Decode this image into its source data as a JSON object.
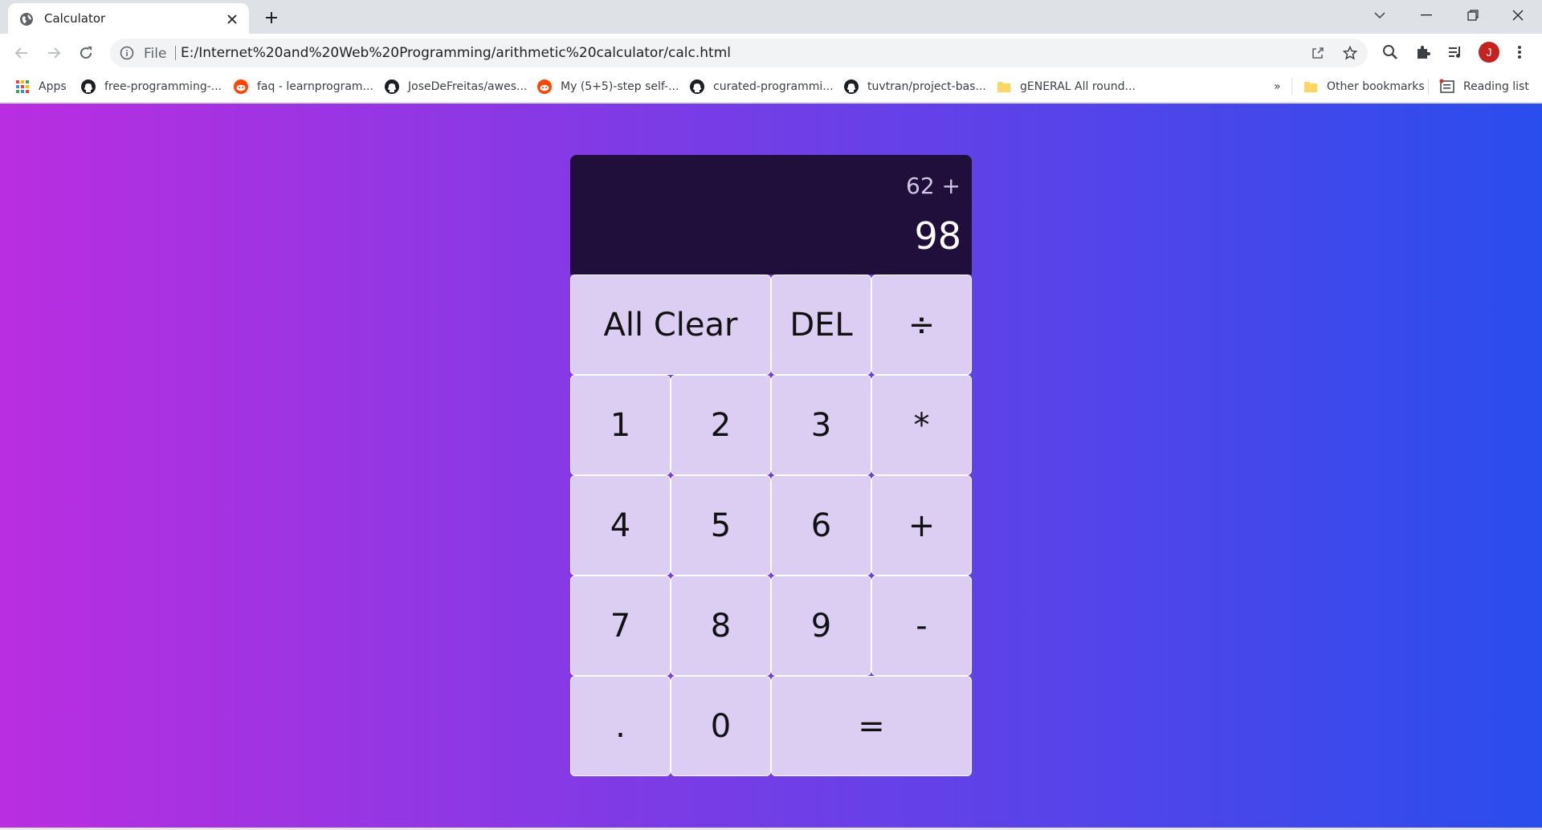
{
  "browser": {
    "tab_title": "Calculator",
    "omnibox_scheme": "File",
    "url": "E:/Internet%20and%20Web%20Programming/arithmetic%20calculator/calc.html",
    "avatar_initial": "J"
  },
  "bookmarks": {
    "items": [
      {
        "label": "Apps",
        "icon": "apps-grid-icon"
      },
      {
        "label": "free-programming-...",
        "icon": "github-icon"
      },
      {
        "label": "faq - learnprogram...",
        "icon": "reddit-icon"
      },
      {
        "label": "JoseDeFreitas/awes...",
        "icon": "github-icon"
      },
      {
        "label": "My (5+5)-step self-...",
        "icon": "reddit-icon"
      },
      {
        "label": "curated-programmi...",
        "icon": "github-icon"
      },
      {
        "label": "tuvtran/project-bas...",
        "icon": "github-icon"
      },
      {
        "label": "gENERAL All round...",
        "icon": "folder-icon"
      }
    ],
    "overflow": "»",
    "other": "Other bookmarks",
    "reading_list": "Reading list"
  },
  "calculator": {
    "previous_operand": "62 +",
    "current_operand": "98",
    "keys": {
      "all_clear": "All Clear",
      "del": "DEL",
      "divide": "÷",
      "one": "1",
      "two": "2",
      "three": "3",
      "multiply": "*",
      "four": "4",
      "five": "5",
      "six": "6",
      "plus": "+",
      "seven": "7",
      "eight": "8",
      "nine": "9",
      "minus": "-",
      "dot": ".",
      "zero": "0",
      "equals": "="
    }
  },
  "colors": {
    "gradient_start": "#b92ee0",
    "gradient_end": "#2a4ded",
    "display_bg": "#1f0f3a",
    "key_bg": "#dccdf3"
  }
}
